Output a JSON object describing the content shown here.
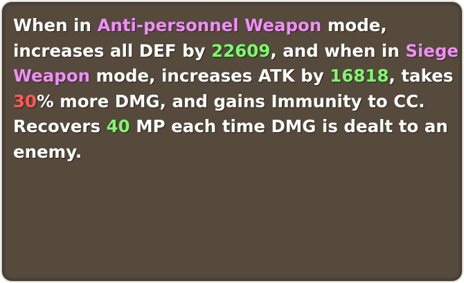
{
  "skill_description": {
    "line1": {
      "t1": "When in ",
      "mode1": "Anti-personnel Weapon",
      "t2": " mode,"
    },
    "line2": {
      "t1": "increases all DEF by ",
      "def_value": "22609",
      "t2": ", and when in ",
      "mode2_part1": "Siege"
    },
    "line3": {
      "mode2_part2": "Weapon",
      "t1": " mode, increases ATK by ",
      "atk_value": "16818",
      "t2": ", takes"
    },
    "line4": {
      "dmg_taken_value": "30",
      "t1": "% more DMG, and gains Immunity to CC."
    },
    "line5": {
      "t1": "Recovers ",
      "mp_value": "40",
      "t2": " MP each time DMG is dealt to an"
    },
    "line6": {
      "t1": "enemy."
    }
  },
  "colors": {
    "panel_background": "#554a3c",
    "mode_highlight": "#f08ef7",
    "value_highlight": "#7dfa6d",
    "penalty_highlight": "#ff5858",
    "text": "#ffffff"
  }
}
